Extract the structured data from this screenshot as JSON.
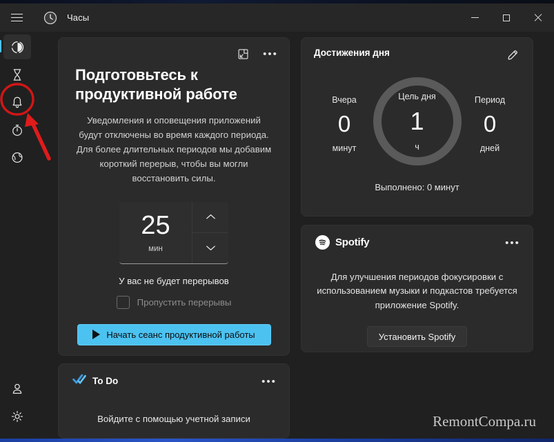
{
  "window": {
    "app_title": "Часы",
    "app_icon": "clock-icon",
    "menu_icon": "hamburger-menu-icon",
    "minimize_label": "—",
    "maximize_label": "□",
    "close_label": "✕"
  },
  "sidebar": {
    "items": [
      {
        "name": "focus-sessions",
        "icon": "focus-sessions-icon",
        "selected": true
      },
      {
        "name": "timer",
        "icon": "hourglass-timer-icon",
        "selected": false
      },
      {
        "name": "alarm",
        "icon": "bell-alarm-icon",
        "selected": false
      },
      {
        "name": "stopwatch",
        "icon": "stopwatch-icon",
        "selected": false
      },
      {
        "name": "world-clock",
        "icon": "globe-world-clock-icon",
        "selected": false
      }
    ],
    "bottom_items": [
      {
        "name": "account",
        "icon": "person-account-icon"
      },
      {
        "name": "settings",
        "icon": "gear-settings-icon"
      }
    ]
  },
  "focus_card": {
    "popout_icon": "mini-view-popout-icon",
    "overflow_icon": "more-options-icon",
    "title": "Подготовьтесь к продуктивной работе",
    "description": "Уведомления и оповещения приложений будут отключены во время каждого периода. Для более длительных периодов мы добавим короткий перерыв, чтобы вы могли восстановить силы.",
    "duration_value": "25",
    "duration_unit": "мин",
    "increase_icon": "chevron-up-icon",
    "decrease_icon": "chevron-down-icon",
    "breaks_info": "У вас не будет перерывов",
    "skip_breaks_label": "Пропустить перерывы",
    "skip_breaks_checked": false,
    "start_button": "Начать сеанс продуктивной работы",
    "start_icon": "play-icon"
  },
  "todo_card": {
    "logo_icon": "todo-checkmark-icon",
    "title": "To Do",
    "overflow_icon": "more-options-icon",
    "body_text": "Войдите с помощью учетной записи"
  },
  "achievements_card": {
    "title": "Достижения дня",
    "edit_icon": "pencil-edit-icon",
    "stats": [
      {
        "label": "Вчера",
        "value": "0",
        "unit": "минут"
      },
      {
        "label": "Цель дня",
        "value": "1",
        "unit": "ч"
      },
      {
        "label": "Период",
        "value": "0",
        "unit": "дней"
      }
    ],
    "completed_text": "Выполнено: 0 минут"
  },
  "spotify_card": {
    "logo_icon": "spotify-logo-icon",
    "brand": "Spotify",
    "overflow_icon": "more-options-icon",
    "description": "Для улучшения периодов фокусировки с использованием музыки и подкастов требуется приложение Spotify.",
    "install_button": "Установить Spotify"
  },
  "annotations": {
    "highlight_target": "bell-alarm-icon",
    "highlight_color": "#d01616",
    "arrow_color": "#e01b1b"
  },
  "watermark": "RemontCompa.ru",
  "colors": {
    "accent": "#4cc2f1",
    "page_bg": "#202020",
    "card_bg": "#2b2b2b",
    "titlebar_bg": "#272727",
    "ring": "#5a5a5a"
  }
}
